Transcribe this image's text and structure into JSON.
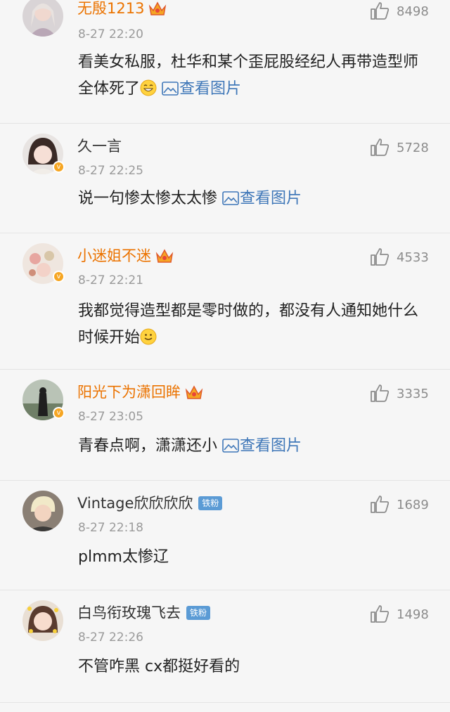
{
  "comments": [
    {
      "user": "无殷1213",
      "time": "8-27 22:20",
      "text": "看美女私服，杜华和某个歪屁股经纪人再带造型师全体死了",
      "emoji": "grin",
      "link": "查看图片",
      "likes": "8498",
      "vip": true,
      "badge": ""
    },
    {
      "user": "久一言",
      "time": "8-27 22:25",
      "text": "说一句惨太惨太太惨",
      "emoji": "",
      "link": "查看图片",
      "likes": "5728",
      "vip": false,
      "badge": ""
    },
    {
      "user": "小迷姐不迷",
      "time": "8-27 22:21",
      "text": "我都觉得造型都是零时做的，都没有人通知她什么时候开始",
      "emoji": "smile",
      "link": "",
      "likes": "4533",
      "vip": true,
      "badge": ""
    },
    {
      "user": "阳光下为潇回眸",
      "time": "8-27 23:05",
      "text": "青春点啊，潇潇还小",
      "emoji": "",
      "link": "查看图片",
      "likes": "3335",
      "vip": true,
      "badge": ""
    },
    {
      "user": "Vintage欣欣欣欣",
      "time": "8-27 22:18",
      "text": "plmm太惨辽",
      "emoji": "",
      "link": "",
      "likes": "1689",
      "vip": false,
      "badge": "铁粉"
    },
    {
      "user": "白鸟衔玫瑰飞去",
      "time": "8-27 22:26",
      "text": "不管咋黑 cx都挺好看的",
      "emoji": "",
      "link": "",
      "likes": "1498",
      "vip": false,
      "badge": "铁粉"
    }
  ],
  "colors": {
    "vip_name": "#eb7300",
    "link": "#3f77b8",
    "fan_badge": "#5b9bd5"
  },
  "icons": {
    "like": "thumbs-up-icon",
    "image_link": "image-icon",
    "crown": "vip-crown-icon"
  }
}
